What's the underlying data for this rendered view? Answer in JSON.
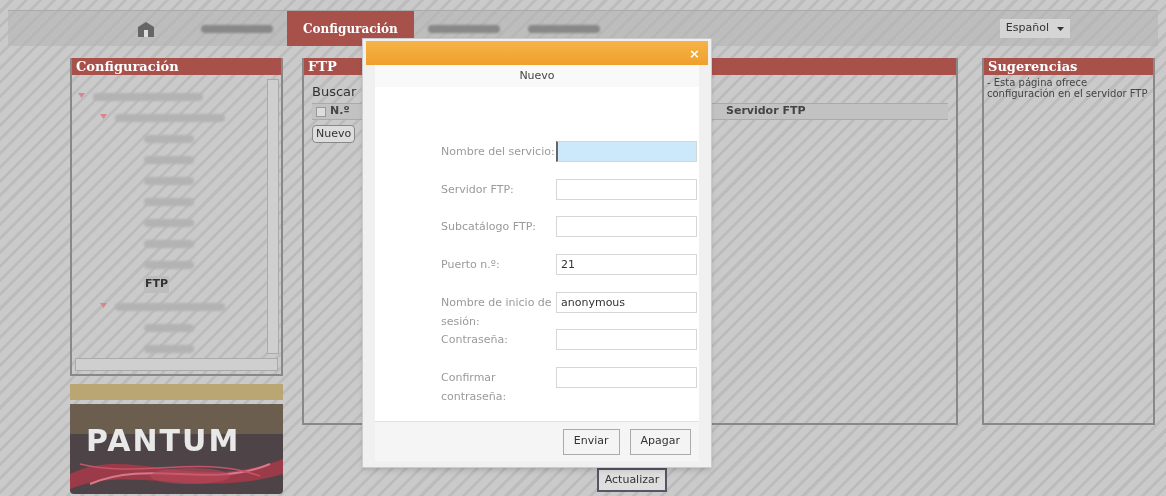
{
  "nav": {
    "items": [
      {
        "kind": "home",
        "selected": false
      },
      {
        "kind": "blurred",
        "selected": false
      },
      {
        "kind": "tab",
        "label": "Configuración",
        "selected": true
      },
      {
        "kind": "blurred",
        "selected": false
      },
      {
        "kind": "blurred",
        "selected": false
      }
    ],
    "language": {
      "value": "Español"
    }
  },
  "sidebar": {
    "title": "Configuración",
    "tree": [
      {
        "expanded": true,
        "selected": false,
        "children": [
          {
            "expanded": true,
            "selected": false,
            "children": [
              {
                "kind": "blurred",
                "selected": false
              },
              {
                "kind": "blurred",
                "selected": false
              },
              {
                "kind": "blurred",
                "selected": false
              },
              {
                "kind": "blurred",
                "selected": false
              },
              {
                "kind": "blurred",
                "selected": false
              },
              {
                "kind": "blurred",
                "selected": false
              },
              {
                "kind": "blurred",
                "selected": false
              },
              {
                "kind": "item",
                "label": "FTP",
                "selected": true
              }
            ]
          },
          {
            "expanded": true,
            "selected": false,
            "children": [
              {
                "kind": "blurred",
                "selected": false
              },
              {
                "kind": "blurred",
                "selected": false
              }
            ]
          }
        ]
      }
    ]
  },
  "logo": {
    "text": "PANTUM"
  },
  "ftp": {
    "title": "FTP",
    "search_label": "Buscar",
    "columns": [
      {
        "kind": "checkbox",
        "label": "N.º",
        "checked": false
      },
      {
        "kind": "text",
        "label": "Servidor FTP"
      }
    ],
    "new_button": "Nuevo",
    "update_button": "Actualizar"
  },
  "hints": {
    "title": "Sugerencias",
    "text": "- Esta página ofrece configuración en el servidor FTP"
  },
  "dialog": {
    "close": "×",
    "title": "Nuevo",
    "fields": [
      {
        "label": "Nombre del servicio:",
        "focused": true
      },
      {
        "label": "Servidor FTP:",
        "focused": false
      },
      {
        "label": "Subcatálogo FTP:",
        "focused": false
      },
      {
        "label": "Puerto n.º:",
        "value": "21",
        "focused": false
      },
      {
        "label": "Nombre de inicio de sesión:",
        "value": "anonymous",
        "focused": false
      },
      {
        "label": "Contraseña:",
        "focused": false
      },
      {
        "label": "Confirmar contraseña:",
        "focused": false
      }
    ],
    "buttons": [
      "Enviar",
      "Apagar"
    ]
  }
}
